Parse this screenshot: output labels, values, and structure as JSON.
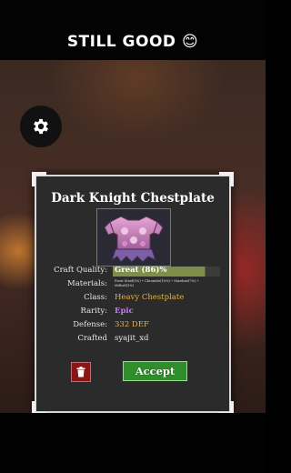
{
  "caption": {
    "text": "STILL GOOD 😊"
  },
  "settings": {
    "icon": "gear-icon"
  },
  "dialog": {
    "title": "Dark Knight Chestplate",
    "item_image": "armor-chestplate-image",
    "craft_quality": {
      "label": "Craft Quality:",
      "value": "Great (86)%",
      "fraction": 0.86
    },
    "materials": {
      "label": "Materials:",
      "value": "Frost Steel(5%) • Chromite(10%) • Stardust(7%) • Mithril(3%)"
    },
    "class": {
      "label": "Class:",
      "value": "Heavy Chestplate"
    },
    "rarity": {
      "label": "Rarity:",
      "value": "Epic"
    },
    "defense": {
      "label": "Defense:",
      "value": "332 DEF"
    },
    "crafted": {
      "label": "Crafted",
      "value": "syajit_xd"
    },
    "delete_icon": "trash-icon",
    "accept_label": "Accept"
  },
  "colors": {
    "quality_bar": "#7e8d48",
    "accept": "#2f8d2b",
    "delete": "#8b1515",
    "epic": "#c27bf2",
    "gold": "#e8b04a"
  }
}
